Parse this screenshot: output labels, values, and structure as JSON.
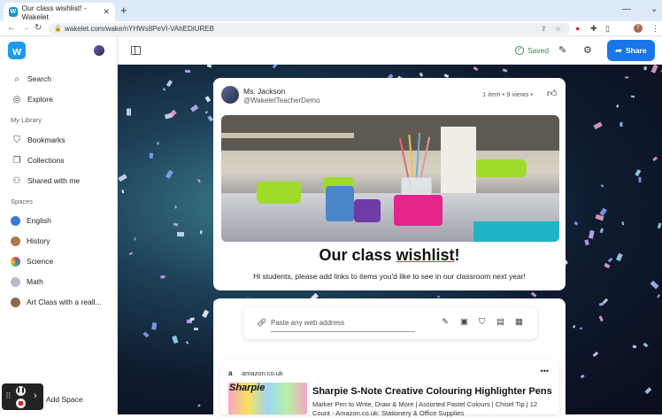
{
  "browser": {
    "tab_title": "Our class wishlist! - Wakelet",
    "tab_favicon": "W",
    "url": "wakelet.com/wake/nYHWs8PeVI-VAhEDiUREB"
  },
  "sidebar": {
    "items": [
      {
        "label": "Search",
        "icon": "search-icon"
      },
      {
        "label": "Explore",
        "icon": "compass-icon"
      }
    ],
    "library_heading": "My Library",
    "library_items": [
      {
        "label": "Bookmarks",
        "icon": "bookmark-icon"
      },
      {
        "label": "Collections",
        "icon": "collections-icon"
      },
      {
        "label": "Shared with me",
        "icon": "users-icon"
      }
    ],
    "spaces_heading": "Spaces",
    "spaces": [
      {
        "label": "English",
        "color": "#3a7bd5"
      },
      {
        "label": "History",
        "color": "#b07a4a"
      },
      {
        "label": "Science",
        "color": "#e0453a"
      },
      {
        "label": "Math",
        "color": "#b9b9c8"
      },
      {
        "label": "Art Class with a reall...",
        "color": "#8a6a4a"
      }
    ],
    "add_space": "Add Space"
  },
  "toolbar": {
    "saved_label": "Saved",
    "share_label": "Share",
    "share_color": "#1876e8"
  },
  "collection": {
    "author_name": "Ms. Jackson",
    "author_handle": "@WakeletTeacherDemo",
    "meta": "1 item  •  9 views  •",
    "title_plain": "Our class ",
    "title_underlined": "wishlist",
    "title_end": "!",
    "description": "Hi students, please add links to items you'd like to see in our classroom next year!"
  },
  "add_bar": {
    "placeholder": "Paste any web address"
  },
  "item": {
    "source": "amazon.co.uk",
    "thumb_brand": "Sharpie",
    "title": "Sharpie S-Note Creative Colouring Highlighter Pens",
    "description": "Marker Pen to Write, Draw & More | Assorted Pastel Colours | Chisel Tip | 12 Count - Amazon.co.uk: Stationery & Office Supplies"
  }
}
